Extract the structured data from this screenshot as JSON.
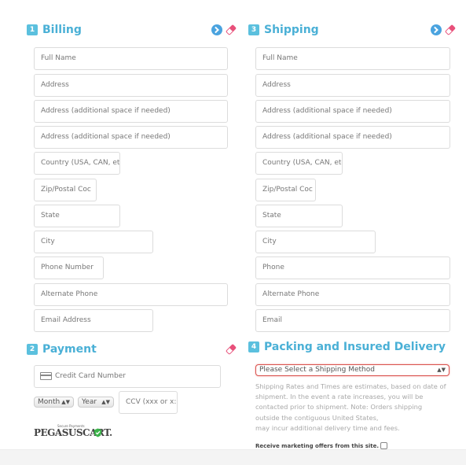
{
  "billing": {
    "number": "1",
    "title": "Billing",
    "fields": [
      {
        "placeholder": "Full Name"
      },
      {
        "placeholder": "Address"
      },
      {
        "placeholder": "Address (additional space if needed)"
      },
      {
        "placeholder": "Address (additional space if needed)"
      },
      {
        "placeholder": "Country (USA, CAN, etc"
      },
      {
        "placeholder": "Zip/Postal Coc"
      },
      {
        "placeholder": "State"
      },
      {
        "placeholder": "City"
      },
      {
        "placeholder": "Phone Number"
      },
      {
        "placeholder": "Alternate Phone"
      },
      {
        "placeholder": "Email Address"
      }
    ]
  },
  "shipping": {
    "number": "3",
    "title": "Shipping",
    "fields": [
      {
        "placeholder": "Full Name"
      },
      {
        "placeholder": "Address"
      },
      {
        "placeholder": "Address (additional space if needed)"
      },
      {
        "placeholder": "Address (additional space if needed)"
      },
      {
        "placeholder": "Country (USA, CAN, etc"
      },
      {
        "placeholder": "Zip/Postal Coc"
      },
      {
        "placeholder": "State"
      },
      {
        "placeholder": "City"
      },
      {
        "placeholder": "Phone"
      },
      {
        "placeholder": "Alternate Phone"
      },
      {
        "placeholder": "Email"
      }
    ]
  },
  "payment": {
    "number": "2",
    "title": "Payment",
    "card_placeholder": "Credit Card Number",
    "month_label": "Month",
    "year_label": "Year",
    "ccv_placeholder": "CCV (xxx or x:",
    "logo_tagline": "Secure Payments",
    "logo_text": "PEGASUSCART."
  },
  "delivery": {
    "number": "4",
    "title": "Packing and Insured Delivery",
    "select_label": "Please Select a Shipping Method",
    "info_lines": [
      "Shipping Rates and Times are estimates, based on date of",
      "shipment. In the event a rate increases, you will be",
      "contacted prior to shipment. Note: Orders shipping",
      "outside the contiguous United States,",
      "may incur additional delivery time and fees."
    ],
    "marketing_label": "Receive marketing offers from this site."
  },
  "colors": {
    "accent": "#4ab0d6",
    "badge": "#5bc0de",
    "error_border": "#d9534f",
    "eraser": "#e8507a"
  },
  "icons": {
    "copy": "arrow-circle-icon",
    "clear": "eraser-icon",
    "card": "credit-card-icon",
    "shield": "shield-check-icon"
  }
}
